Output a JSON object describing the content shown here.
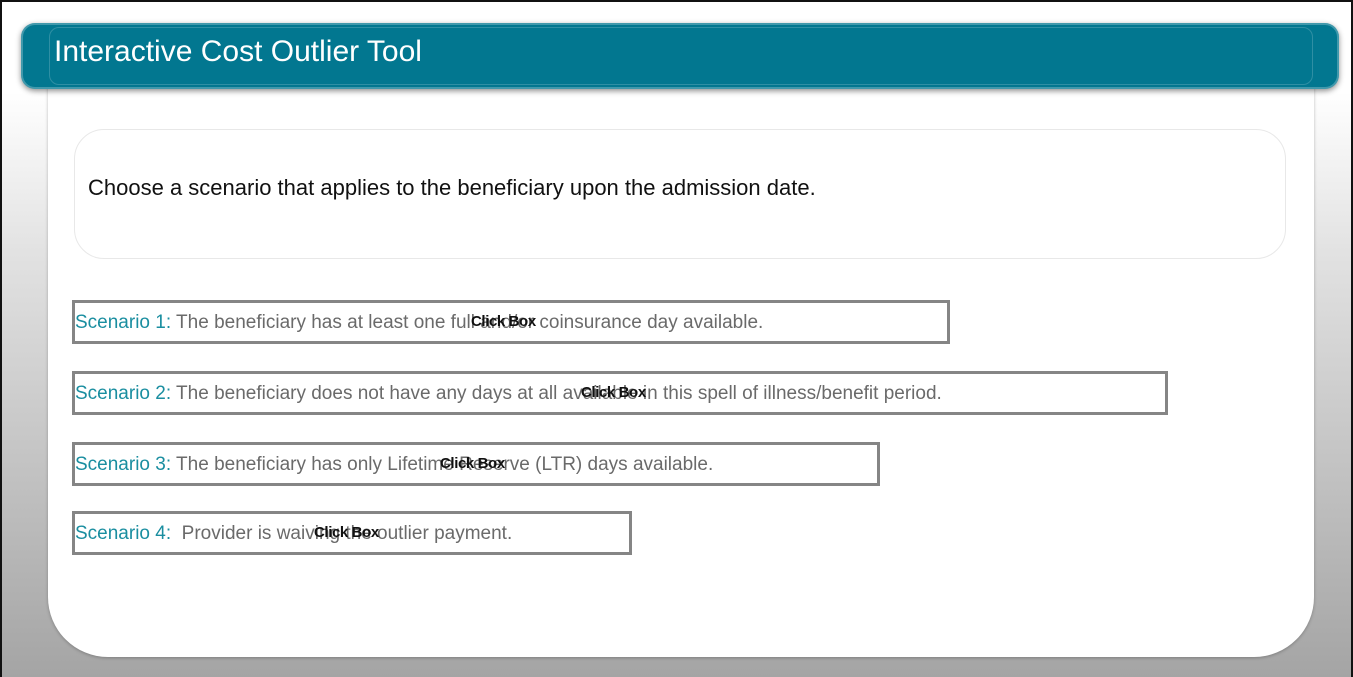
{
  "header": {
    "title": "Interactive Cost Outlier Tool"
  },
  "prompt": {
    "text": "Choose a scenario that applies to the beneficiary upon the admission date."
  },
  "scenarios": [
    {
      "label": "Scenario 1:",
      "text": " The beneficiary has at least one full and/or coinsurance day available.",
      "overlay": "Click Box"
    },
    {
      "label": "Scenario 2:",
      "text": " The beneficiary does not have any days at all available in this spell of illness/benefit period.",
      "overlay": "Click Box"
    },
    {
      "label": "Scenario 3:",
      "text": " The beneficiary has only Lifetime Reserve (LTR) days available.",
      "overlay": "Click Box"
    },
    {
      "label": "Scenario 4:",
      "text": "  Provider is waiving the outlier payment.",
      "overlay": "Click Box"
    }
  ],
  "colors": {
    "header_bg": "#027790",
    "scenario_label": "#1a8ea0",
    "scenario_text": "#6a6a6a",
    "scenario_border": "#858585"
  }
}
